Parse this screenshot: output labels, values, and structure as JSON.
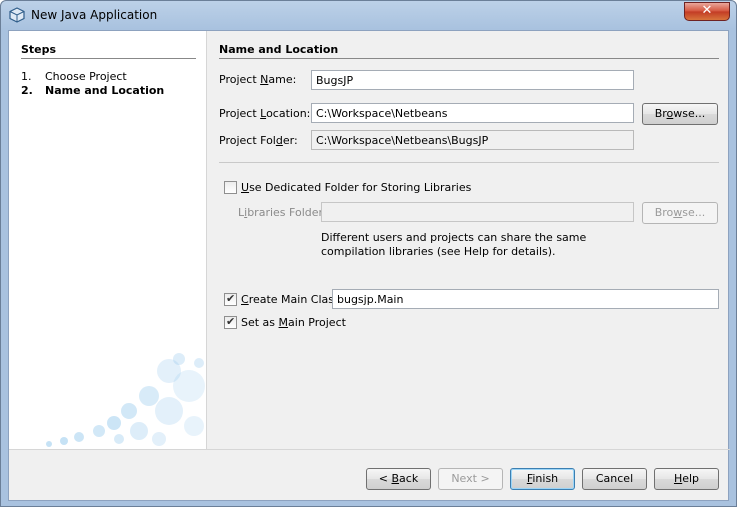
{
  "window": {
    "title": "New Java Application",
    "close_symbol": "✕"
  },
  "steps": {
    "title": "Steps",
    "items": [
      {
        "num": "1.",
        "label": "Choose Project",
        "current": false
      },
      {
        "num": "2.",
        "label": "Name and Location",
        "current": true
      }
    ]
  },
  "main": {
    "title": "Name and Location",
    "project_name": {
      "label_pre": "Project ",
      "label_u": "N",
      "label_post": "ame:",
      "value": "BugsJP"
    },
    "project_location": {
      "label_pre": "Project ",
      "label_u": "L",
      "label_post": "ocation:",
      "value": "C:\\Workspace\\Netbeans",
      "browse_pre": "Br",
      "browse_u": "o",
      "browse_post": "wse..."
    },
    "project_folder": {
      "label_pre": "Project Fol",
      "label_u": "d",
      "label_post": "er:",
      "value": "C:\\Workspace\\Netbeans\\BugsJP"
    },
    "dedicated_folder": {
      "label_u": "U",
      "label_post": "se Dedicated Folder for Storing Libraries",
      "checked": false
    },
    "libraries_folder": {
      "label_pre": "L",
      "label_u": "i",
      "label_post": "braries Folder:",
      "value": "",
      "browse_pre": "Bro",
      "browse_u": "w",
      "browse_post": "se..."
    },
    "help_text": "Different users and projects can share the same compilation libraries (see Help for details).",
    "create_main_class": {
      "label_u": "C",
      "label_post": "reate Main Class",
      "checked": true,
      "value": "bugsjp.Main"
    },
    "set_main_project": {
      "label_pre": "Set as ",
      "label_u": "M",
      "label_post": "ain Project",
      "checked": true
    }
  },
  "buttons": {
    "back": {
      "pre": "< ",
      "u": "B",
      "post": "ack"
    },
    "next": {
      "label": "Next >"
    },
    "finish": {
      "pre": "",
      "u": "F",
      "post": "inish"
    },
    "cancel": {
      "label": "Cancel"
    },
    "help": {
      "pre": "",
      "u": "H",
      "post": "elp"
    }
  }
}
